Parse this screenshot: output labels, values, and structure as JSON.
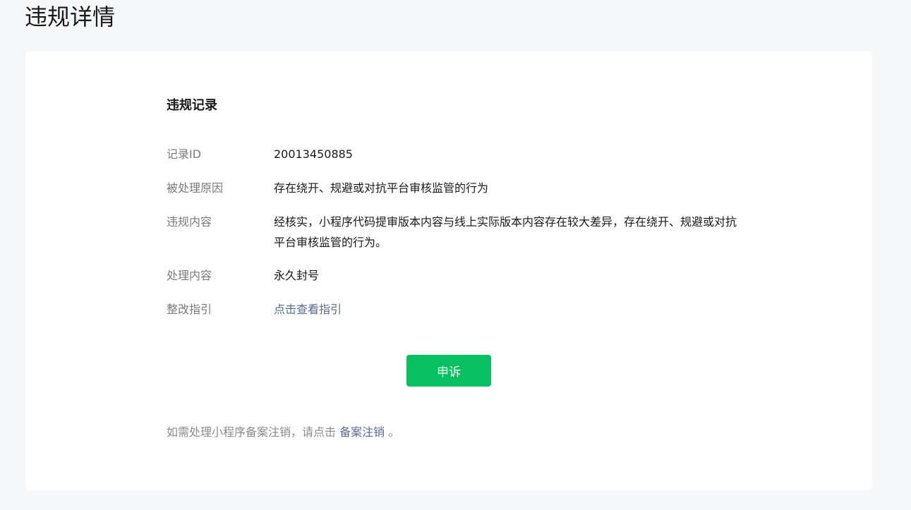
{
  "header": {
    "title": "违规详情"
  },
  "record": {
    "section_title": "违规记录",
    "fields": [
      {
        "label": "记录ID",
        "value": "20013450885"
      },
      {
        "label": "被处理原因",
        "value": "存在绕开、规避或对抗平台审核监管的行为"
      },
      {
        "label": "违规内容",
        "value": "经核实，小程序代码提审版本内容与线上实际版本内容存在较大差异，存在绕开、规避或对抗平台审核监管的行为。"
      },
      {
        "label": "处理内容",
        "value": "永久封号"
      },
      {
        "label": "整改指引",
        "value": "点击查看指引"
      }
    ]
  },
  "actions": {
    "appeal_label": "申诉"
  },
  "footer": {
    "prefix": "如需处理小程序备案注销，请点击",
    "link": "备案注销",
    "suffix": "。"
  },
  "colors": {
    "background": "#f6f7f9",
    "card": "#ffffff",
    "primary_button": "#07c160",
    "link": "#576b95",
    "label": "#7a7a7a",
    "text": "#1a1a1a"
  }
}
